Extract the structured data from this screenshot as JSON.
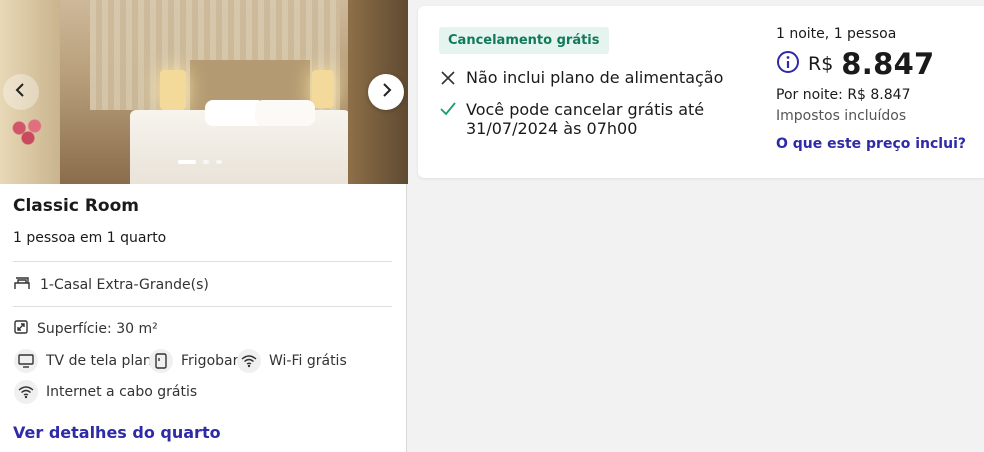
{
  "room": {
    "title": "Classic Room",
    "occupancy": "1 pessoa em 1 quarto",
    "bed": "1-Casal Extra-Grande(s)",
    "area": "Superfície: 30 m²",
    "amenities": [
      {
        "label": "TV de tela plana",
        "icon": "tv-icon"
      },
      {
        "label": "Frigobar",
        "icon": "minibar-icon"
      },
      {
        "label": "Wi-Fi grátis",
        "icon": "wifi-icon"
      },
      {
        "label": "Internet a cabo grátis",
        "icon": "wired-internet-icon"
      }
    ],
    "details_link": "Ver detalhes do quarto",
    "gallery": {
      "total_images": 3,
      "active_index": 0
    }
  },
  "rate": {
    "badge": "Cancelamento grátis",
    "policies": [
      {
        "icon": "x-icon",
        "text": "Não inclui plano de alimentação"
      },
      {
        "icon": "check-icon",
        "text": "Você pode cancelar grátis até 31/07/2024 às 07h00"
      }
    ],
    "nights_guests": "1 noite, 1 pessoa",
    "currency": "R$",
    "total_price": "8.847",
    "per_night": "Por noite: R$ 8.847",
    "taxes": "Impostos incluídos",
    "includes_link": "O que este preço inclui?"
  },
  "colors": {
    "link": "#2e2aa8",
    "badge_bg": "#e6f4ef",
    "badge_text": "#117a5a",
    "check": "#1a9e6e",
    "info": "#2e2aa8"
  }
}
